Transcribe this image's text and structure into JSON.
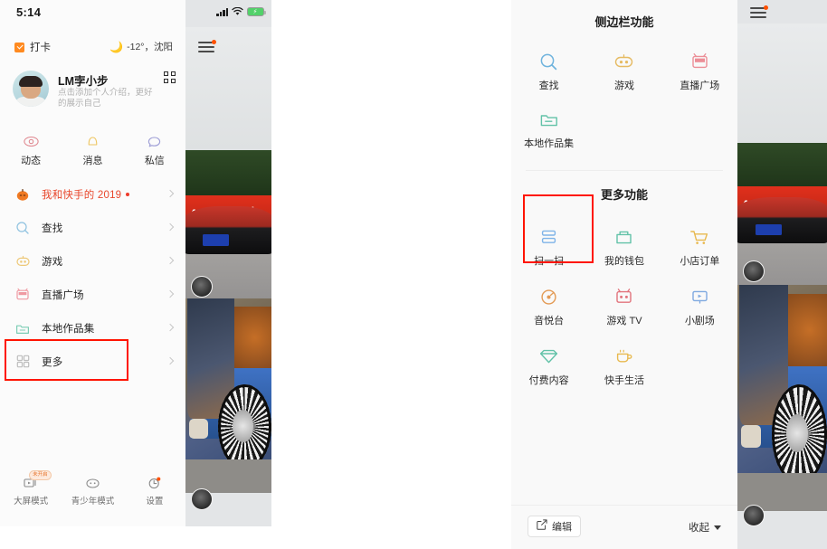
{
  "left_phone": {
    "status_bar": {
      "time": "5:14"
    },
    "check_in": {
      "label": "打卡",
      "icon": "checkbox-check-icon"
    },
    "weather": {
      "icon": "moon-icon",
      "text": "-12°，沈阳"
    },
    "profile": {
      "name": "LM孛小步",
      "qr_icon": "qr-code-icon",
      "description": "点击添加个人介绍，更好的展示自己"
    },
    "tabs": [
      {
        "label": "动态",
        "icon": "eye-icon"
      },
      {
        "label": "消息",
        "icon": "bell-icon"
      },
      {
        "label": "私信",
        "icon": "chat-bubble-icon"
      }
    ],
    "menu": [
      {
        "label": "我和快手的 2019",
        "icon": "pumpkin-icon",
        "highlight": true,
        "dot": true
      },
      {
        "label": "查找",
        "icon": "search-icon",
        "highlight": false,
        "dot": false
      },
      {
        "label": "游戏",
        "icon": "game-robot-icon",
        "highlight": false,
        "dot": false
      },
      {
        "label": "直播广场",
        "icon": "live-tv-icon",
        "highlight": false,
        "dot": false
      },
      {
        "label": "本地作品集",
        "icon": "folder-icon",
        "highlight": false,
        "dot": false
      },
      {
        "label": "更多",
        "icon": "grid-icon",
        "highlight": false,
        "dot": false
      }
    ],
    "bottom_bar": [
      {
        "label": "大屏模式",
        "icon": "big-screen-icon",
        "badge": "未开启"
      },
      {
        "label": "青少年模式",
        "icon": "teen-mode-icon",
        "badge": ""
      },
      {
        "label": "设置",
        "icon": "settings-icon",
        "badge": ""
      }
    ],
    "video": {
      "banner_text": "40w买保时",
      "hamburger_icon": "hamburger-menu-icon"
    }
  },
  "right_phone": {
    "sidebar_section": {
      "title": "侧边栏功能",
      "items": [
        {
          "label": "查找",
          "icon": "search-icon"
        },
        {
          "label": "游戏",
          "icon": "game-robot-icon"
        },
        {
          "label": "直播广场",
          "icon": "live-tv-icon"
        },
        {
          "label": "本地作品集",
          "icon": "folder-icon"
        }
      ]
    },
    "more_section": {
      "title": "更多功能",
      "items": [
        {
          "label": "扫一扫",
          "icon": "scan-icon"
        },
        {
          "label": "我的钱包",
          "icon": "wallet-icon"
        },
        {
          "label": "小店订单",
          "icon": "shopping-cart-icon"
        },
        {
          "label": "音悦台",
          "icon": "music-disc-icon"
        },
        {
          "label": "游戏 TV",
          "icon": "game-tv-icon"
        },
        {
          "label": "小剧场",
          "icon": "theater-screen-icon"
        },
        {
          "label": "付费内容",
          "icon": "diamond-icon"
        },
        {
          "label": "快手生活",
          "icon": "coffee-cup-icon"
        }
      ]
    },
    "bottom_bar": {
      "edit_label": "编辑",
      "edit_icon": "edit-square-icon",
      "collapse_label": "收起",
      "collapse_icon": "caret-down-icon"
    },
    "video": {
      "banner_text": "40w买保",
      "hamburger_icon": "hamburger-menu-icon"
    }
  },
  "annotations": {
    "highlight_color": "#ff1400",
    "boxes": [
      {
        "name": "more-menu-highlight",
        "target": "更多"
      },
      {
        "name": "scan-highlight",
        "target": "扫一扫"
      }
    ]
  }
}
